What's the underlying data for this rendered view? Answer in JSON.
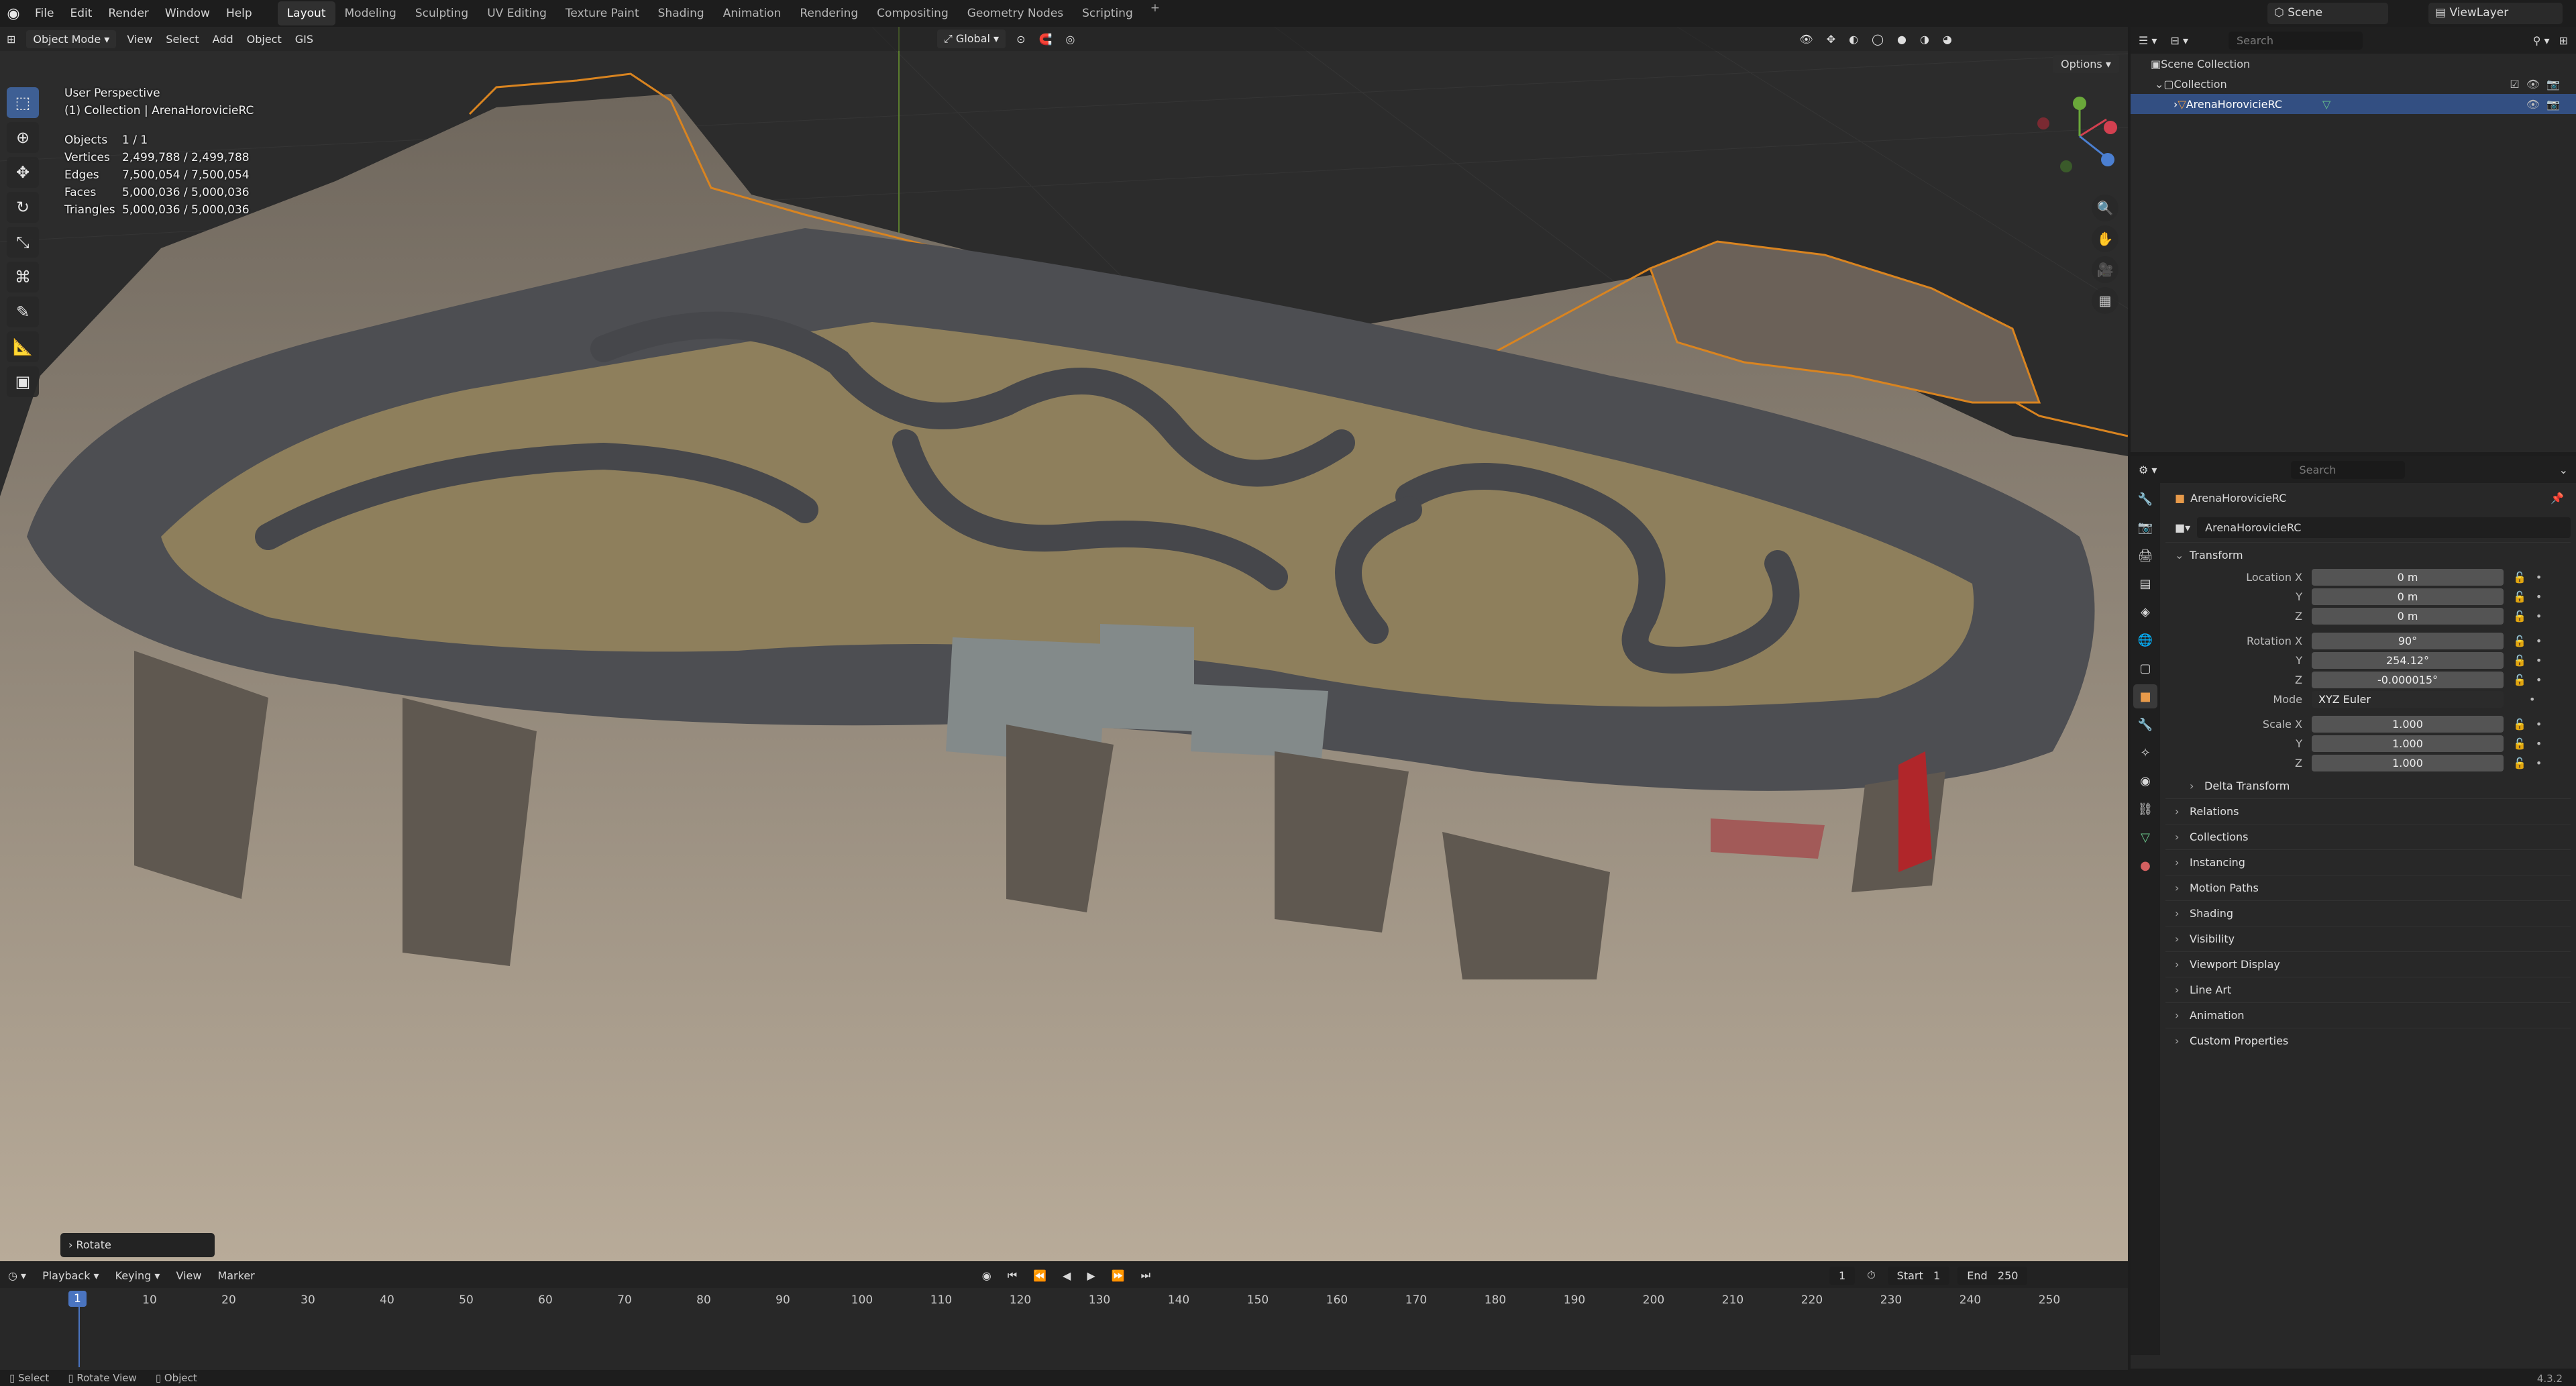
{
  "menu": {
    "items": [
      "File",
      "Edit",
      "Render",
      "Window",
      "Help"
    ]
  },
  "workspaces": {
    "tabs": [
      "Layout",
      "Modeling",
      "Sculpting",
      "UV Editing",
      "Texture Paint",
      "Shading",
      "Animation",
      "Rendering",
      "Compositing",
      "Geometry Nodes",
      "Scripting"
    ],
    "add": "+"
  },
  "scene": {
    "name": "Scene",
    "view_layer": "ViewLayer"
  },
  "viewport_header": {
    "mode": "Object Mode",
    "items": [
      "View",
      "Select",
      "Add",
      "Object",
      "GIS"
    ],
    "transform_orientation": "Global",
    "options": "Options"
  },
  "overlay": {
    "view_name": "User Perspective",
    "collection": "(1) Collection | ArenaHorovicieRC",
    "stats": [
      {
        "key": "Objects",
        "value": "1 / 1"
      },
      {
        "key": "Vertices",
        "value": "2,499,788 / 2,499,788"
      },
      {
        "key": "Edges",
        "value": "7,500,054 / 7,500,054"
      },
      {
        "key": "Faces",
        "value": "5,000,036 / 5,000,036"
      },
      {
        "key": "Triangles",
        "value": "5,000,036 / 5,000,036"
      }
    ]
  },
  "last_operator": "Rotate",
  "outliner": {
    "search_placeholder": "Search",
    "items": [
      "Scene Collection",
      "Collection",
      "ArenaHorovicieRC"
    ]
  },
  "properties": {
    "search_placeholder": "Search",
    "object_name": "ArenaHorovicieRC",
    "object_field": "ArenaHorovicieRC",
    "transform_title": "Transform",
    "rows": [
      {
        "label": "Location X",
        "value": "0 m"
      },
      {
        "label": "Y",
        "value": "0 m"
      },
      {
        "label": "Z",
        "value": "0 m"
      },
      {
        "label": "Rotation X",
        "value": "90°"
      },
      {
        "label": "Y",
        "value": "254.12°"
      },
      {
        "label": "Z",
        "value": "-0.000015°"
      },
      {
        "label": "Mode",
        "value": "XYZ Euler"
      },
      {
        "label": "Scale X",
        "value": "1.000"
      },
      {
        "label": "Y",
        "value": "1.000"
      },
      {
        "label": "Z",
        "value": "1.000"
      }
    ],
    "delta": "Delta Transform",
    "sections": [
      "Relations",
      "Collections",
      "Instancing",
      "Motion Paths",
      "Shading",
      "Visibility",
      "Viewport Display",
      "Line Art",
      "Animation",
      "Custom Properties"
    ]
  },
  "timeline": {
    "items": [
      "Playback",
      "Keying",
      "View",
      "Marker"
    ],
    "current_frame": "1",
    "start_label": "Start",
    "start": "1",
    "end_label": "End",
    "end": "250",
    "ticks": [
      "1",
      "10",
      "20",
      "30",
      "40",
      "50",
      "60",
      "70",
      "80",
      "90",
      "100",
      "110",
      "120",
      "130",
      "140",
      "150",
      "160",
      "170",
      "180",
      "190",
      "200",
      "210",
      "220",
      "230",
      "240",
      "250"
    ]
  },
  "statusbar": {
    "items": [
      "Select",
      "Rotate View",
      "Object"
    ],
    "version": "4.3.2"
  }
}
